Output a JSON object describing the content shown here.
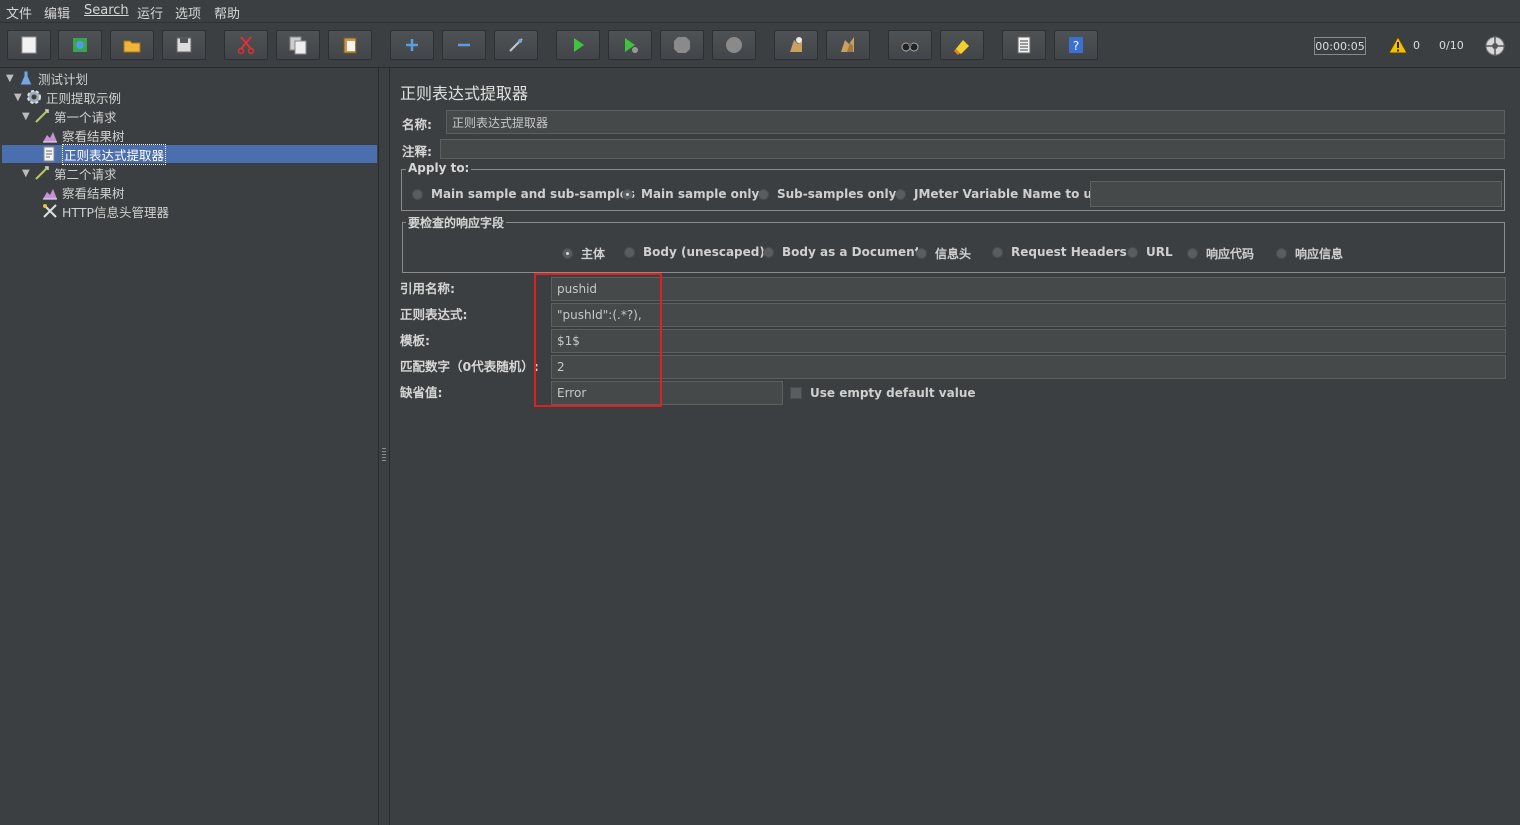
{
  "menu": {
    "file": "文件",
    "edit": "编辑",
    "search": "Search",
    "run": "运行",
    "options": "选项",
    "help": "帮助"
  },
  "toolbar": {
    "timer": "00:00:05",
    "warning_count": "0",
    "thread_ratio": "0/10",
    "icons": [
      "new-icon",
      "templates-icon",
      "open-icon",
      "save-icon",
      "cut-icon",
      "copy-icon",
      "paste-icon",
      "expand-icon",
      "collapse-icon",
      "toggle-icon",
      "start-icon",
      "start-no-pause-icon",
      "stop-icon",
      "shutdown-icon",
      "clear-icon",
      "clear-all-icon",
      "search-icon",
      "reset-search-icon",
      "function-helper-icon",
      "help-icon"
    ]
  },
  "tree": {
    "items": [
      {
        "label": "测试计划",
        "icon": "test-plan-icon",
        "expanded": true
      },
      {
        "label": "正则提取示例",
        "icon": "thread-group-icon",
        "expanded": true
      },
      {
        "label": "第一个请求",
        "icon": "sampler-icon",
        "expanded": true
      },
      {
        "label": "察看结果树",
        "icon": "listener-icon"
      },
      {
        "label": "正则表达式提取器",
        "icon": "extractor-icon",
        "selected": true
      },
      {
        "label": "第二个请求",
        "icon": "sampler-icon",
        "expanded": true
      },
      {
        "label": "察看结果树",
        "icon": "listener-icon"
      },
      {
        "label": "HTTP信息头管理器",
        "icon": "header-manager-icon"
      }
    ]
  },
  "panel": {
    "title": "正则表达式提取器",
    "name_label": "名称:",
    "name_value": "正则表达式提取器",
    "comment_label": "注释:",
    "comment_value": "",
    "apply_to": {
      "legend": "Apply to:",
      "options": [
        "Main sample and sub-samples",
        "Main sample only",
        "Sub-samples only",
        "JMeter Variable Name to use"
      ],
      "selected": "Main sample only",
      "variable_value": ""
    },
    "field_to_check": {
      "legend": "要检查的响应字段",
      "options": [
        "主体",
        "Body (unescaped)",
        "Body as a Document",
        "信息头",
        "Request Headers",
        "URL",
        "响应代码",
        "响应信息"
      ],
      "selected": "主体"
    },
    "ref_name_label": "引用名称:",
    "ref_name_value": "pushid",
    "regex_label": "正则表达式:",
    "regex_value": "\"pushId\":(.*?),",
    "template_label": "模板:",
    "template_value": "$1$",
    "match_no_label": "匹配数字（0代表随机）:",
    "match_no_value": "2",
    "default_label": "缺省值:",
    "default_value": "Error",
    "empty_default_label": "Use empty default value",
    "empty_default_checked": false
  },
  "colors": {
    "background": "#3c3f41",
    "selection": "#4b6eaf",
    "highlight": "#e02020"
  }
}
